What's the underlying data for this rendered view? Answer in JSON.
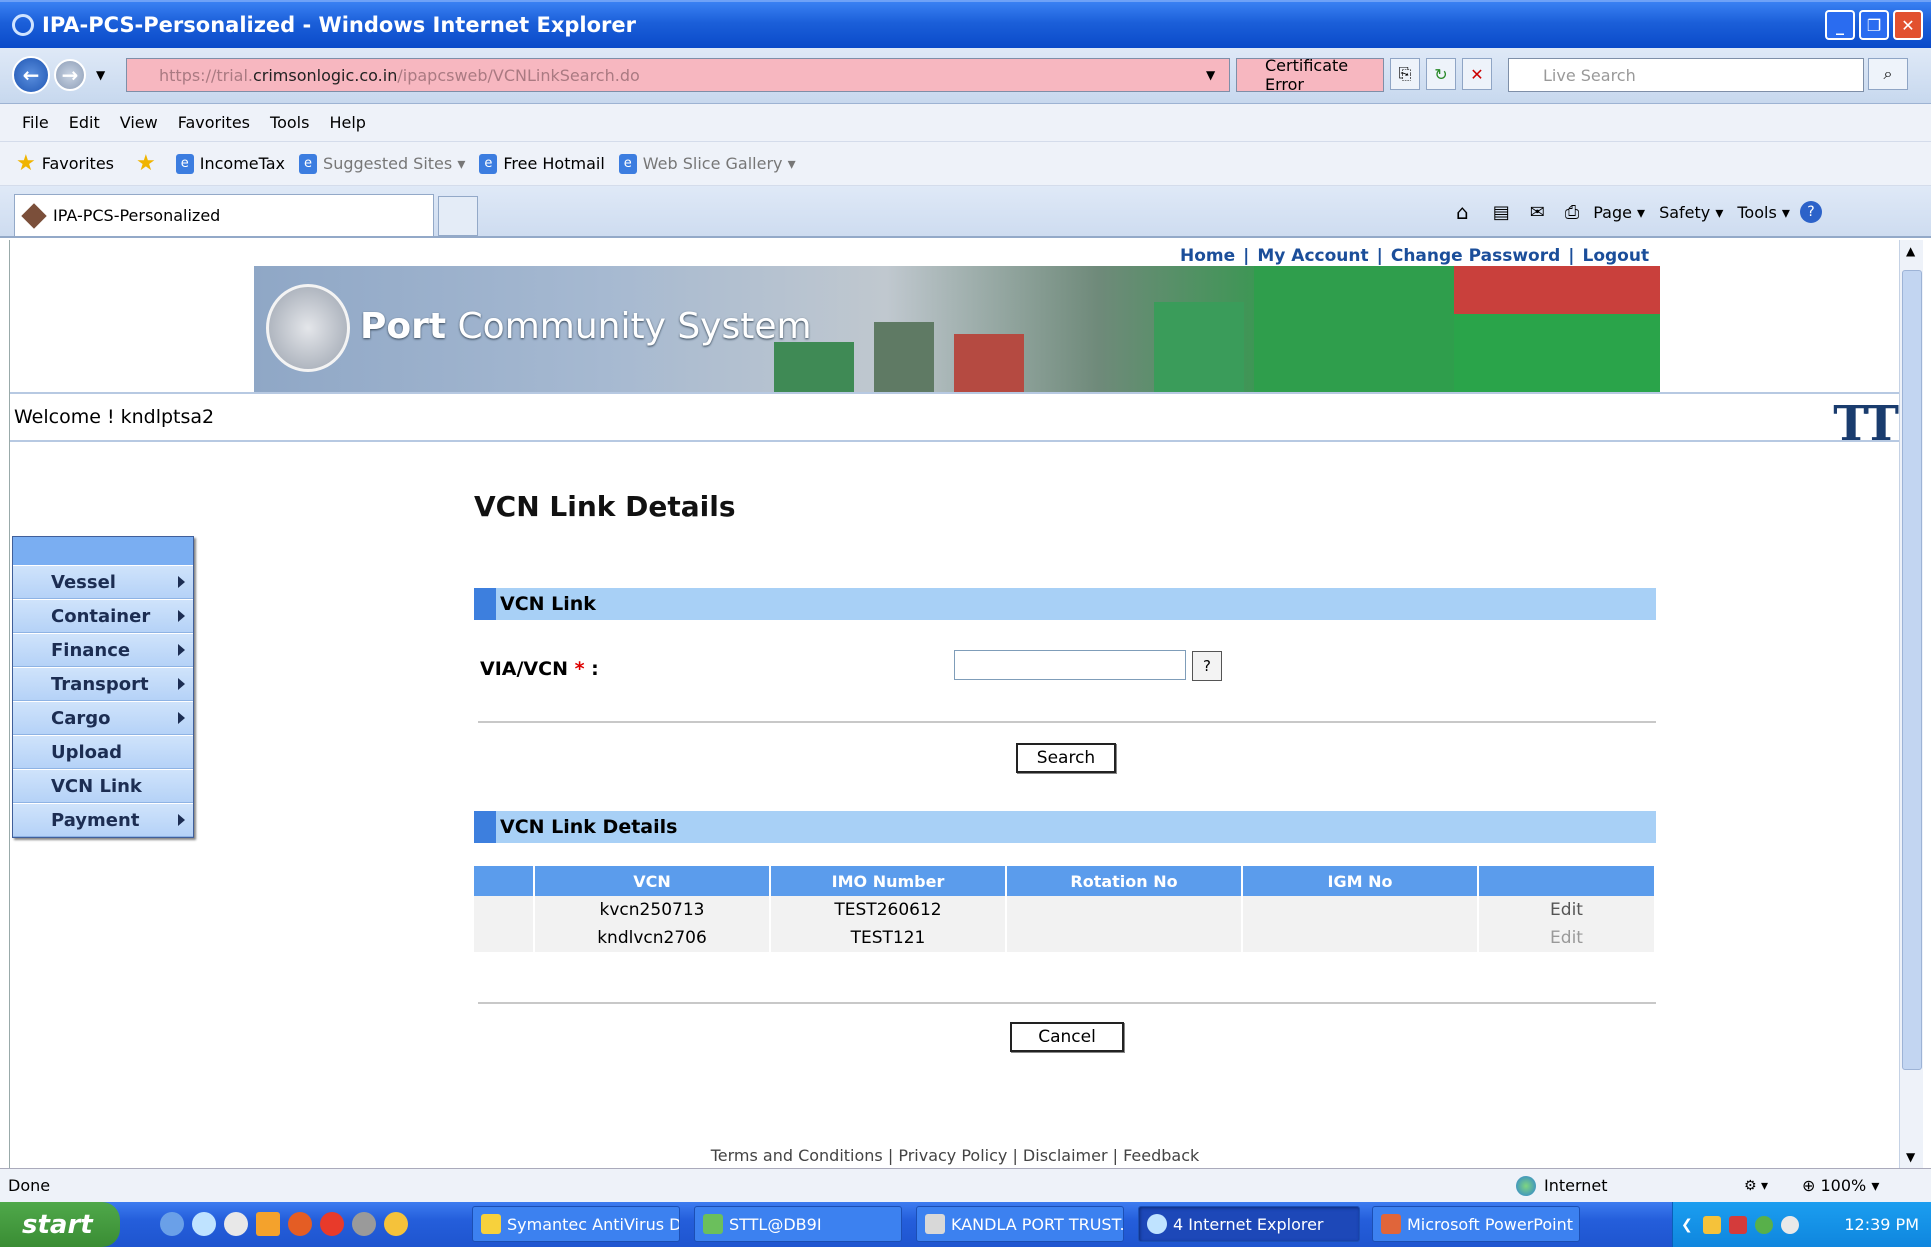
{
  "window": {
    "title": "IPA-PCS-Personalized - Windows Internet Explorer"
  },
  "addressbar": {
    "url_prefix": "https://trial.",
    "url_domain": "crimsonlogic.co.in",
    "url_path": "/ipapcsweb/VCNLinkSearch.do",
    "cert_error": "Certificate Error",
    "search_placeholder": "Live Search"
  },
  "menubar": [
    "File",
    "Edit",
    "View",
    "Favorites",
    "Tools",
    "Help"
  ],
  "favbar": {
    "favorites": "Favorites",
    "items": [
      "IncomeTax",
      "Suggested Sites ▾",
      "Free Hotmail",
      "Web Slice Gallery ▾"
    ]
  },
  "tabbar": {
    "tab_title": "IPA-PCS-Personalized",
    "commands": [
      "Page ▾",
      "Safety ▾",
      "Tools ▾"
    ]
  },
  "page": {
    "toplinks": [
      "Home",
      "My Account",
      "Change Password",
      "Logout"
    ],
    "banner_word1": "Port",
    "banner_word2": " Community System",
    "welcome": "Welcome ! kndlptsa2",
    "tt_logo": "TT",
    "title": "VCN Link Details",
    "nav": [
      {
        "label": "Vessel",
        "submenu": true
      },
      {
        "label": "Container",
        "submenu": true
      },
      {
        "label": "Finance",
        "submenu": true
      },
      {
        "label": "Transport",
        "submenu": true
      },
      {
        "label": "Cargo",
        "submenu": true
      },
      {
        "label": "Upload",
        "submenu": false
      },
      {
        "label": "VCN Link",
        "submenu": false
      },
      {
        "label": "Payment",
        "submenu": true
      }
    ],
    "section1": "VCN Link",
    "via_label": "VIA/VCN",
    "via_required": "*",
    "via_colon": " :",
    "via_value": "",
    "help": "?",
    "search_btn": "Search",
    "section2": "VCN Link Details",
    "table": {
      "headers": [
        "",
        "VCN",
        "IMO Number",
        "Rotation No",
        "IGM No",
        ""
      ],
      "rows": [
        [
          "",
          "kvcn250713",
          "TEST260612",
          "",
          "",
          "Edit"
        ],
        [
          "",
          "kndlvcn2706",
          "TEST121",
          "",
          "",
          "Edit"
        ]
      ]
    },
    "cancel_btn": "Cancel",
    "footer": "Terms and Conditions | Privacy Policy | Disclaimer | Feedback"
  },
  "statusbar": {
    "status": "Done",
    "zone": "Internet",
    "zoom": "100%"
  },
  "taskbar": {
    "start": "start",
    "buttons": [
      "Symantec AntiVirus D...",
      "STTL@DB9I",
      "KANDLA PORT TRUST...",
      "4 Internet Explorer",
      "Microsoft PowerPoint ..."
    ],
    "clock": "12:39 PM"
  },
  "colors": {
    "section_header": "#a8d0f6",
    "section_accent": "#3d7fde",
    "table_header": "#5b9cec",
    "link": "#1b4e9a"
  }
}
